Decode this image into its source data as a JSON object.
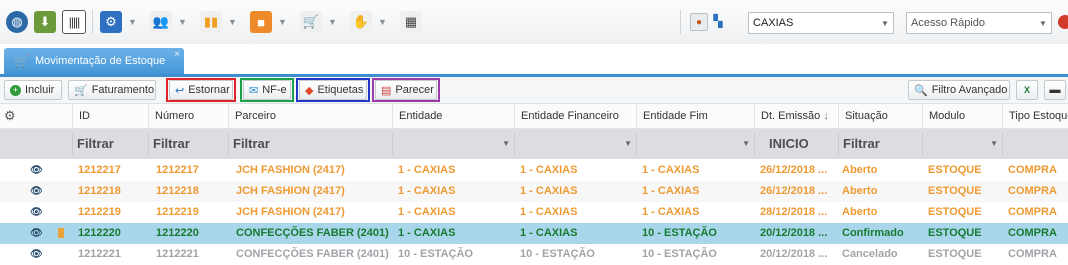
{
  "toolbar": {
    "location_value": "CAXIAS",
    "quick_access_value": "Acesso Rápido"
  },
  "tab": {
    "title": "Movimentação de Estoque",
    "close": "×"
  },
  "actions": {
    "incluir": "Incluir",
    "faturamento": "Faturamento",
    "estornar": "Estornar",
    "nfe": "NF-e",
    "etiquetas": "Etiquetas",
    "parecer": "Parecer",
    "filtro_avancado": "Filtro Avançado"
  },
  "highlight_colors": {
    "estornar": "#e0242b",
    "nfe": "#18a04a",
    "etiquetas": "#2435c4",
    "parecer": "#9b3aa8"
  },
  "grid": {
    "columns": [
      "ID",
      "Número",
      "Parceiro",
      "Entidade",
      "Entidade Financeiro",
      "Entidade Fim",
      "Dt. Emissão",
      "Situação",
      "Modulo",
      "Tipo Estoque"
    ],
    "sort_icon": "↓",
    "filters": {
      "id": "Filtrar",
      "numero": "Filtrar",
      "parceiro": "Filtrar",
      "dt_emissao": "INICIO",
      "situacao": "Filtrar"
    },
    "rows": [
      {
        "id": "1212217",
        "numero": "1212217",
        "parceiro": "JCH FASHION (2417)",
        "entidade": "1 - CAXIAS",
        "entidade_fin": "1 - CAXIAS",
        "entidade_fim": "1 - CAXIAS",
        "dt": "26/12/2018 ...",
        "situacao": "Aberto",
        "modulo": "ESTOQUE",
        "tipo": "COMPRA"
      },
      {
        "id": "1212218",
        "numero": "1212218",
        "parceiro": "JCH FASHION (2417)",
        "entidade": "1 - CAXIAS",
        "entidade_fin": "1 - CAXIAS",
        "entidade_fim": "1 - CAXIAS",
        "dt": "26/12/2018 ...",
        "situacao": "Aberto",
        "modulo": "ESTOQUE",
        "tipo": "COMPRA"
      },
      {
        "id": "1212219",
        "numero": "1212219",
        "parceiro": "JCH FASHION (2417)",
        "entidade": "1 - CAXIAS",
        "entidade_fin": "1 - CAXIAS",
        "entidade_fim": "1 - CAXIAS",
        "dt": "28/12/2018 ...",
        "situacao": "Aberto",
        "modulo": "ESTOQUE",
        "tipo": "COMPRA"
      },
      {
        "id": "1212220",
        "numero": "1212220",
        "parceiro": "CONFECÇÕES FABER (2401)",
        "entidade": "1 - CAXIAS",
        "entidade_fin": "1 - CAXIAS",
        "entidade_fim": "10 - ESTAÇÃO",
        "dt": "20/12/2018 ...",
        "situacao": "Confirmado",
        "modulo": "ESTOQUE",
        "tipo": "COMPRA"
      },
      {
        "id": "1212221",
        "numero": "1212221",
        "parceiro": "CONFECÇÕES FABER (2401)",
        "entidade": "10 - ESTAÇÃO",
        "entidade_fin": "10 - ESTAÇÃO",
        "entidade_fim": "10 - ESTAÇÃO",
        "dt": "20/12/2018 ...",
        "situacao": "Cancelado",
        "modulo": "ESTOQUE",
        "tipo": "COMPRA"
      }
    ]
  }
}
